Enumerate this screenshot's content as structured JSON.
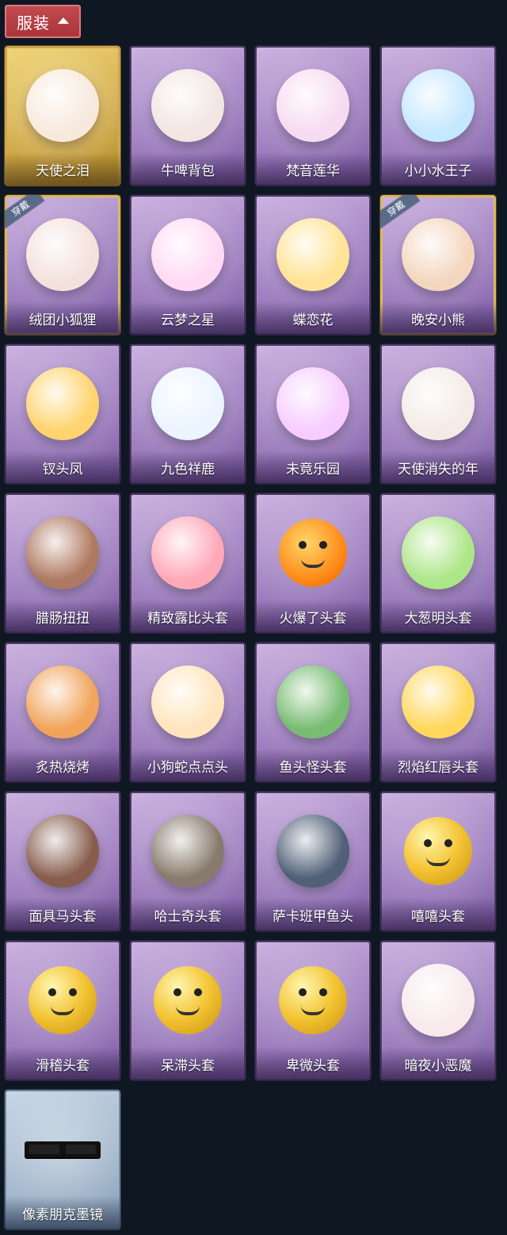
{
  "header": {
    "title": "服装"
  },
  "badges": {
    "wearing": "穿戴"
  },
  "items": [
    {
      "label": "天使之泪",
      "style": "gold",
      "icon": "angel-icon"
    },
    {
      "label": "牛啤背包",
      "style": "purple",
      "icon": "cow-barrel-icon"
    },
    {
      "label": "梵音莲华",
      "style": "purple",
      "icon": "lotus-fairy-icon"
    },
    {
      "label": "小小水王子",
      "style": "purple",
      "icon": "water-prince-icon"
    },
    {
      "label": "绒团小狐狸",
      "style": "purple",
      "icon": "fox-charm-icon",
      "wearing": true
    },
    {
      "label": "云梦之星",
      "style": "purple",
      "icon": "unicorn-star-icon"
    },
    {
      "label": "蝶恋花",
      "style": "purple",
      "icon": "bell-wreath-icon"
    },
    {
      "label": "晚安小熊",
      "style": "purple",
      "icon": "bear-charm-icon",
      "wearing": true
    },
    {
      "label": "钗头凤",
      "style": "purple",
      "icon": "phoenix-crown-icon"
    },
    {
      "label": "九色祥鹿",
      "style": "purple",
      "icon": "deer-charm-icon"
    },
    {
      "label": "未竟乐园",
      "style": "purple",
      "icon": "bunny-girl-icon"
    },
    {
      "label": "天使消失的年",
      "style": "purple",
      "icon": "veil-girl-icon"
    },
    {
      "label": "腊肠扭扭",
      "style": "purple",
      "icon": "sausage-dog-icon"
    },
    {
      "label": "精致露比头套",
      "style": "purple",
      "icon": "pink-beaver-icon"
    },
    {
      "label": "火爆了头套",
      "style": "purple",
      "icon": "fire-mask-icon"
    },
    {
      "label": "大葱明头套",
      "style": "purple",
      "icon": "green-onion-icon"
    },
    {
      "label": "炙热烧烤",
      "style": "purple",
      "icon": "bbq-mask-icon"
    },
    {
      "label": "小狗蛇点点头",
      "style": "purple",
      "icon": "snake-dog-icon"
    },
    {
      "label": "鱼头怪头套",
      "style": "purple",
      "icon": "fish-mask-icon"
    },
    {
      "label": "烈焰红唇头套",
      "style": "purple",
      "icon": "yellow-pokemon-icon"
    },
    {
      "label": "面具马头套",
      "style": "purple",
      "icon": "horse-mask-icon"
    },
    {
      "label": "哈士奇头套",
      "style": "purple",
      "icon": "husky-mask-icon"
    },
    {
      "label": "萨卡班甲鱼头",
      "style": "purple",
      "icon": "whale-mask-icon"
    },
    {
      "label": "嘻嘻头套",
      "style": "purple",
      "icon": "grin-emoji-icon"
    },
    {
      "label": "滑稽头套",
      "style": "purple",
      "icon": "laugh-emoji-icon"
    },
    {
      "label": "呆滞头套",
      "style": "purple",
      "icon": "stare-emoji-icon"
    },
    {
      "label": "卑微头套",
      "style": "purple",
      "icon": "shy-emoji-icon"
    },
    {
      "label": "暗夜小恶魔",
      "style": "purple",
      "icon": "devil-head-icon"
    },
    {
      "label": "像素朋克墨镜",
      "style": "blue",
      "icon": "pixel-shades-icon"
    }
  ]
}
